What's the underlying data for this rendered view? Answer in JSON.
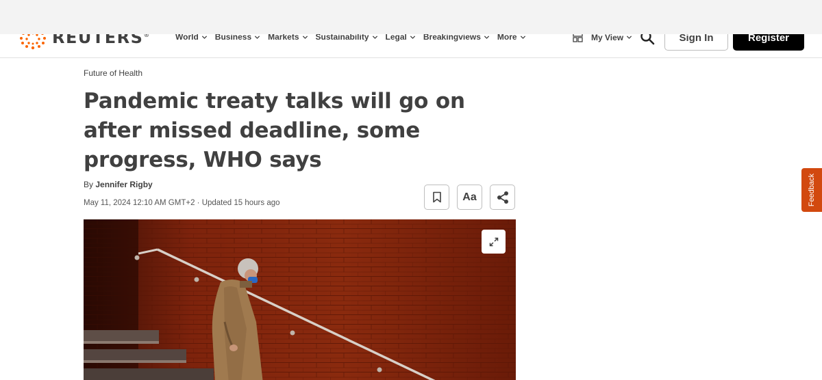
{
  "header": {
    "logo_text": "REUTERS",
    "logo_mark": "®",
    "nav": [
      {
        "label": "World"
      },
      {
        "label": "Business"
      },
      {
        "label": "Markets"
      },
      {
        "label": "Sustainability"
      },
      {
        "label": "Legal"
      },
      {
        "label": "Breakingviews"
      },
      {
        "label": "More"
      }
    ],
    "my_view_label": "My View",
    "sign_in_label": "Sign In",
    "register_label": "Register"
  },
  "article": {
    "kicker": "Future of Health",
    "headline": "Pandemic treaty talks will go on after missed deadline, some progress, WHO says",
    "byline_prefix": "By ",
    "author": "Jennifer Rigby",
    "dateline": "May 11, 2024 12:10 AM GMT+2 · Updated 15 hours ago",
    "font_size_label": "Aa"
  },
  "feedback_label": "Feedback",
  "colors": {
    "accent_orange": "#d2490f",
    "register_bg": "#000000",
    "text": "#404040"
  },
  "icons": [
    "reuters-logo-icon",
    "chevron-down-icon",
    "my-view-grid-icon",
    "search-icon",
    "bookmark-icon",
    "share-icon",
    "expand-icon"
  ]
}
